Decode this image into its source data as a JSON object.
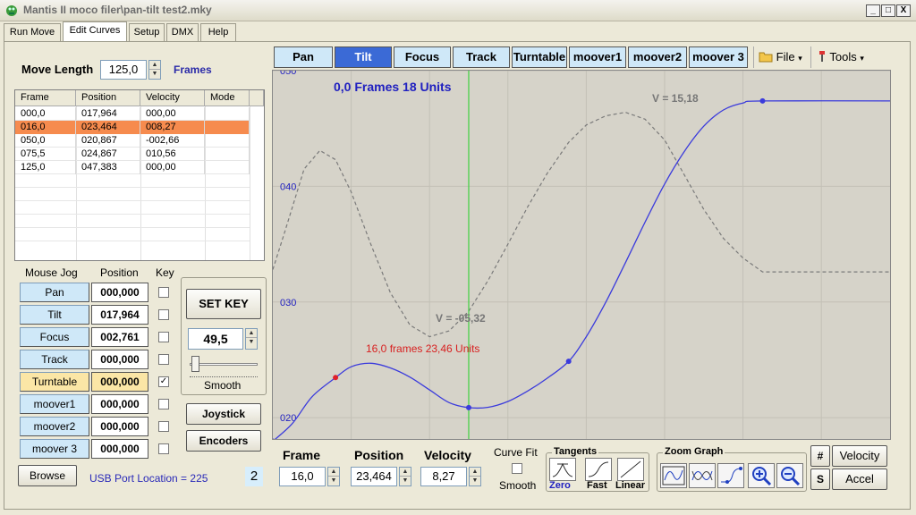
{
  "window": {
    "title": "Mantis II    moco filer\\pan-tilt test2.mky",
    "min_glyph": "_",
    "max_glyph": "□",
    "close_glyph": "X"
  },
  "tabs": [
    "Run Move",
    "Edit Curves",
    "Setup",
    "DMX",
    "Help"
  ],
  "move_length": {
    "label": "Move Length",
    "value": "125,0",
    "unit": "Frames"
  },
  "keyframe_table": {
    "columns": [
      "Frame",
      "Position",
      "Velocity",
      "Mode"
    ],
    "rows": [
      [
        "000,0",
        "017,964",
        "000,00",
        ""
      ],
      [
        "016,0",
        "023,464",
        "008,27",
        ""
      ],
      [
        "050,0",
        "020,867",
        "-002,66",
        ""
      ],
      [
        "075,5",
        "024,867",
        "010,56",
        ""
      ],
      [
        "125,0",
        "047,383",
        "000,00",
        ""
      ]
    ],
    "selected_row": 1
  },
  "jog": {
    "headers": {
      "mouse_jog": "Mouse Jog",
      "position": "Position",
      "key": "Key"
    },
    "axes": [
      {
        "name": "Pan",
        "position": "000,000",
        "key": false
      },
      {
        "name": "Tilt",
        "position": "017,964",
        "key": false
      },
      {
        "name": "Focus",
        "position": "002,761",
        "key": false
      },
      {
        "name": "Track",
        "position": "000,000",
        "key": false
      },
      {
        "name": "Turntable",
        "position": "000,000",
        "key": true
      },
      {
        "name": "moover1",
        "position": "000,000",
        "key": false
      },
      {
        "name": "moover2",
        "position": "000,000",
        "key": false
      },
      {
        "name": "moover 3",
        "position": "000,000",
        "key": false
      }
    ],
    "highlighted_index": 4
  },
  "set_key": {
    "label": "SET KEY",
    "value": "49,5",
    "smooth_label": "Smooth",
    "slider_fraction": 0.08
  },
  "joystick_label": "Joystick",
  "encoders_label": "Encoders",
  "browse_label": "Browse",
  "usb_port": "USB Port Location = 225",
  "port_number": "2",
  "axis_tabs": [
    "Pan",
    "Tilt",
    "Focus",
    "Track",
    "Turntable",
    "moover1",
    "moover2",
    "moover 3"
  ],
  "active_axis_tab": 1,
  "menu": {
    "file": "File",
    "tools": "Tools"
  },
  "graph": {
    "header": "0,0 Frames  18 Units",
    "y_ticks": [
      "050",
      "040",
      "030",
      "020"
    ],
    "velocity_max_label": "V = 15,18",
    "velocity_min_label": "V = -05,32",
    "point_label": "16,0 frames 23,46 Units",
    "colors": {
      "position": "#3b3bdc",
      "velocity": "#7a7a7a",
      "cursor": "#3fd13f",
      "selected": "#e0202a",
      "label_blue": "#2020c0"
    }
  },
  "chart_data": {
    "type": "line",
    "title": "0,0 Frames  18 Units",
    "ylim": [
      18,
      50
    ],
    "xlim": [
      0,
      158
    ],
    "yticks": [
      20,
      30,
      40,
      50
    ],
    "grid": true,
    "cursor_frame": 50,
    "keyframes": [
      {
        "frame": 0.0,
        "position": 17.964
      },
      {
        "frame": 16.0,
        "position": 23.464
      },
      {
        "frame": 50.0,
        "position": 20.867
      },
      {
        "frame": 75.5,
        "position": 24.867
      },
      {
        "frame": 125.0,
        "position": 47.383
      }
    ],
    "series": [
      {
        "values_x": [
          0,
          5,
          10,
          16,
          20,
          25,
          30,
          35,
          40,
          45,
          50,
          55,
          60,
          65,
          70,
          75.5,
          80,
          85,
          90,
          95,
          100,
          105,
          110,
          115,
          120,
          125,
          158
        ],
        "values_y": [
          17.96,
          19.5,
          21.8,
          23.46,
          24.4,
          24.7,
          24.3,
          23.5,
          22.4,
          21.3,
          20.87,
          20.9,
          21.4,
          22.3,
          23.4,
          24.87,
          27.0,
          30.0,
          33.4,
          36.9,
          40.2,
          43.0,
          45.2,
          46.6,
          47.2,
          47.38,
          47.38
        ]
      },
      {
        "values_x": [
          0,
          3,
          8,
          12,
          16,
          20,
          25,
          30,
          35,
          40,
          45,
          50,
          55,
          60,
          65,
          70,
          75.5,
          80,
          85,
          90,
          95,
          100,
          105,
          110,
          115,
          120,
          125,
          158
        ],
        "values_y": [
          32.8,
          36,
          41.5,
          43.1,
          42.3,
          39.5,
          35.0,
          30.8,
          28.0,
          27.0,
          27.5,
          29.2,
          31.9,
          35.0,
          38.2,
          41.1,
          43.8,
          45.3,
          46.1,
          46.4,
          45.8,
          44.0,
          41.0,
          38.0,
          35.5,
          33.8,
          32.6,
          32.6
        ]
      }
    ]
  },
  "bottom": {
    "frame": {
      "label": "Frame",
      "value": "16,0"
    },
    "position": {
      "label": "Position",
      "value": "23,464"
    },
    "velocity": {
      "label": "Velocity",
      "value": "8,27"
    },
    "curve_fit": "Curve Fit",
    "smooth": "Smooth",
    "tangents": {
      "title": "Tangents",
      "zero": "Zero",
      "fast": "Fast",
      "linear": "Linear"
    },
    "zoom": {
      "title": "Zoom Graph"
    },
    "hash": "#",
    "s": "S",
    "velocity_btn": "Velocity",
    "accel_btn": "Accel"
  }
}
